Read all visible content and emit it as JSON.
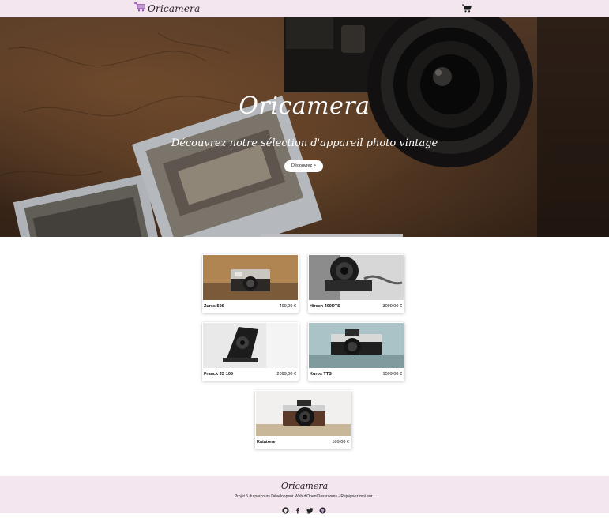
{
  "navbar": {
    "brand": "Oricamera",
    "brand_icon": "cart-logo-icon",
    "cart_icon": "shopping-cart-icon"
  },
  "hero": {
    "title": "Oricamera",
    "subtitle": "Découvrez notre sélection d'appareil photo vintage",
    "button_label": "Découvrez >"
  },
  "products": [
    {
      "name": "Zurss 50S",
      "price": "499,00 €"
    },
    {
      "name": "Hirsch 400DTS",
      "price": "3099,00 €"
    },
    {
      "name": "Franck JS 105",
      "price": "2099,00 €"
    },
    {
      "name": "Kuros TTS",
      "price": "1599,00 €"
    },
    {
      "name": "Katatone",
      "price": "599,00 €"
    }
  ],
  "footer": {
    "logo": "Oricamera",
    "text": "Projet 5 du parcours Développeur Web d'OpenClassrooms - Rejoignez moi sur :",
    "social_icons": [
      "github-icon",
      "facebook-icon",
      "twitter-icon",
      "keybase-icon"
    ]
  },
  "colors": {
    "navbar_bg": "#f3e6ef",
    "footer_bg": "#f3e6ef",
    "brand_accent": "#9b59b6"
  }
}
